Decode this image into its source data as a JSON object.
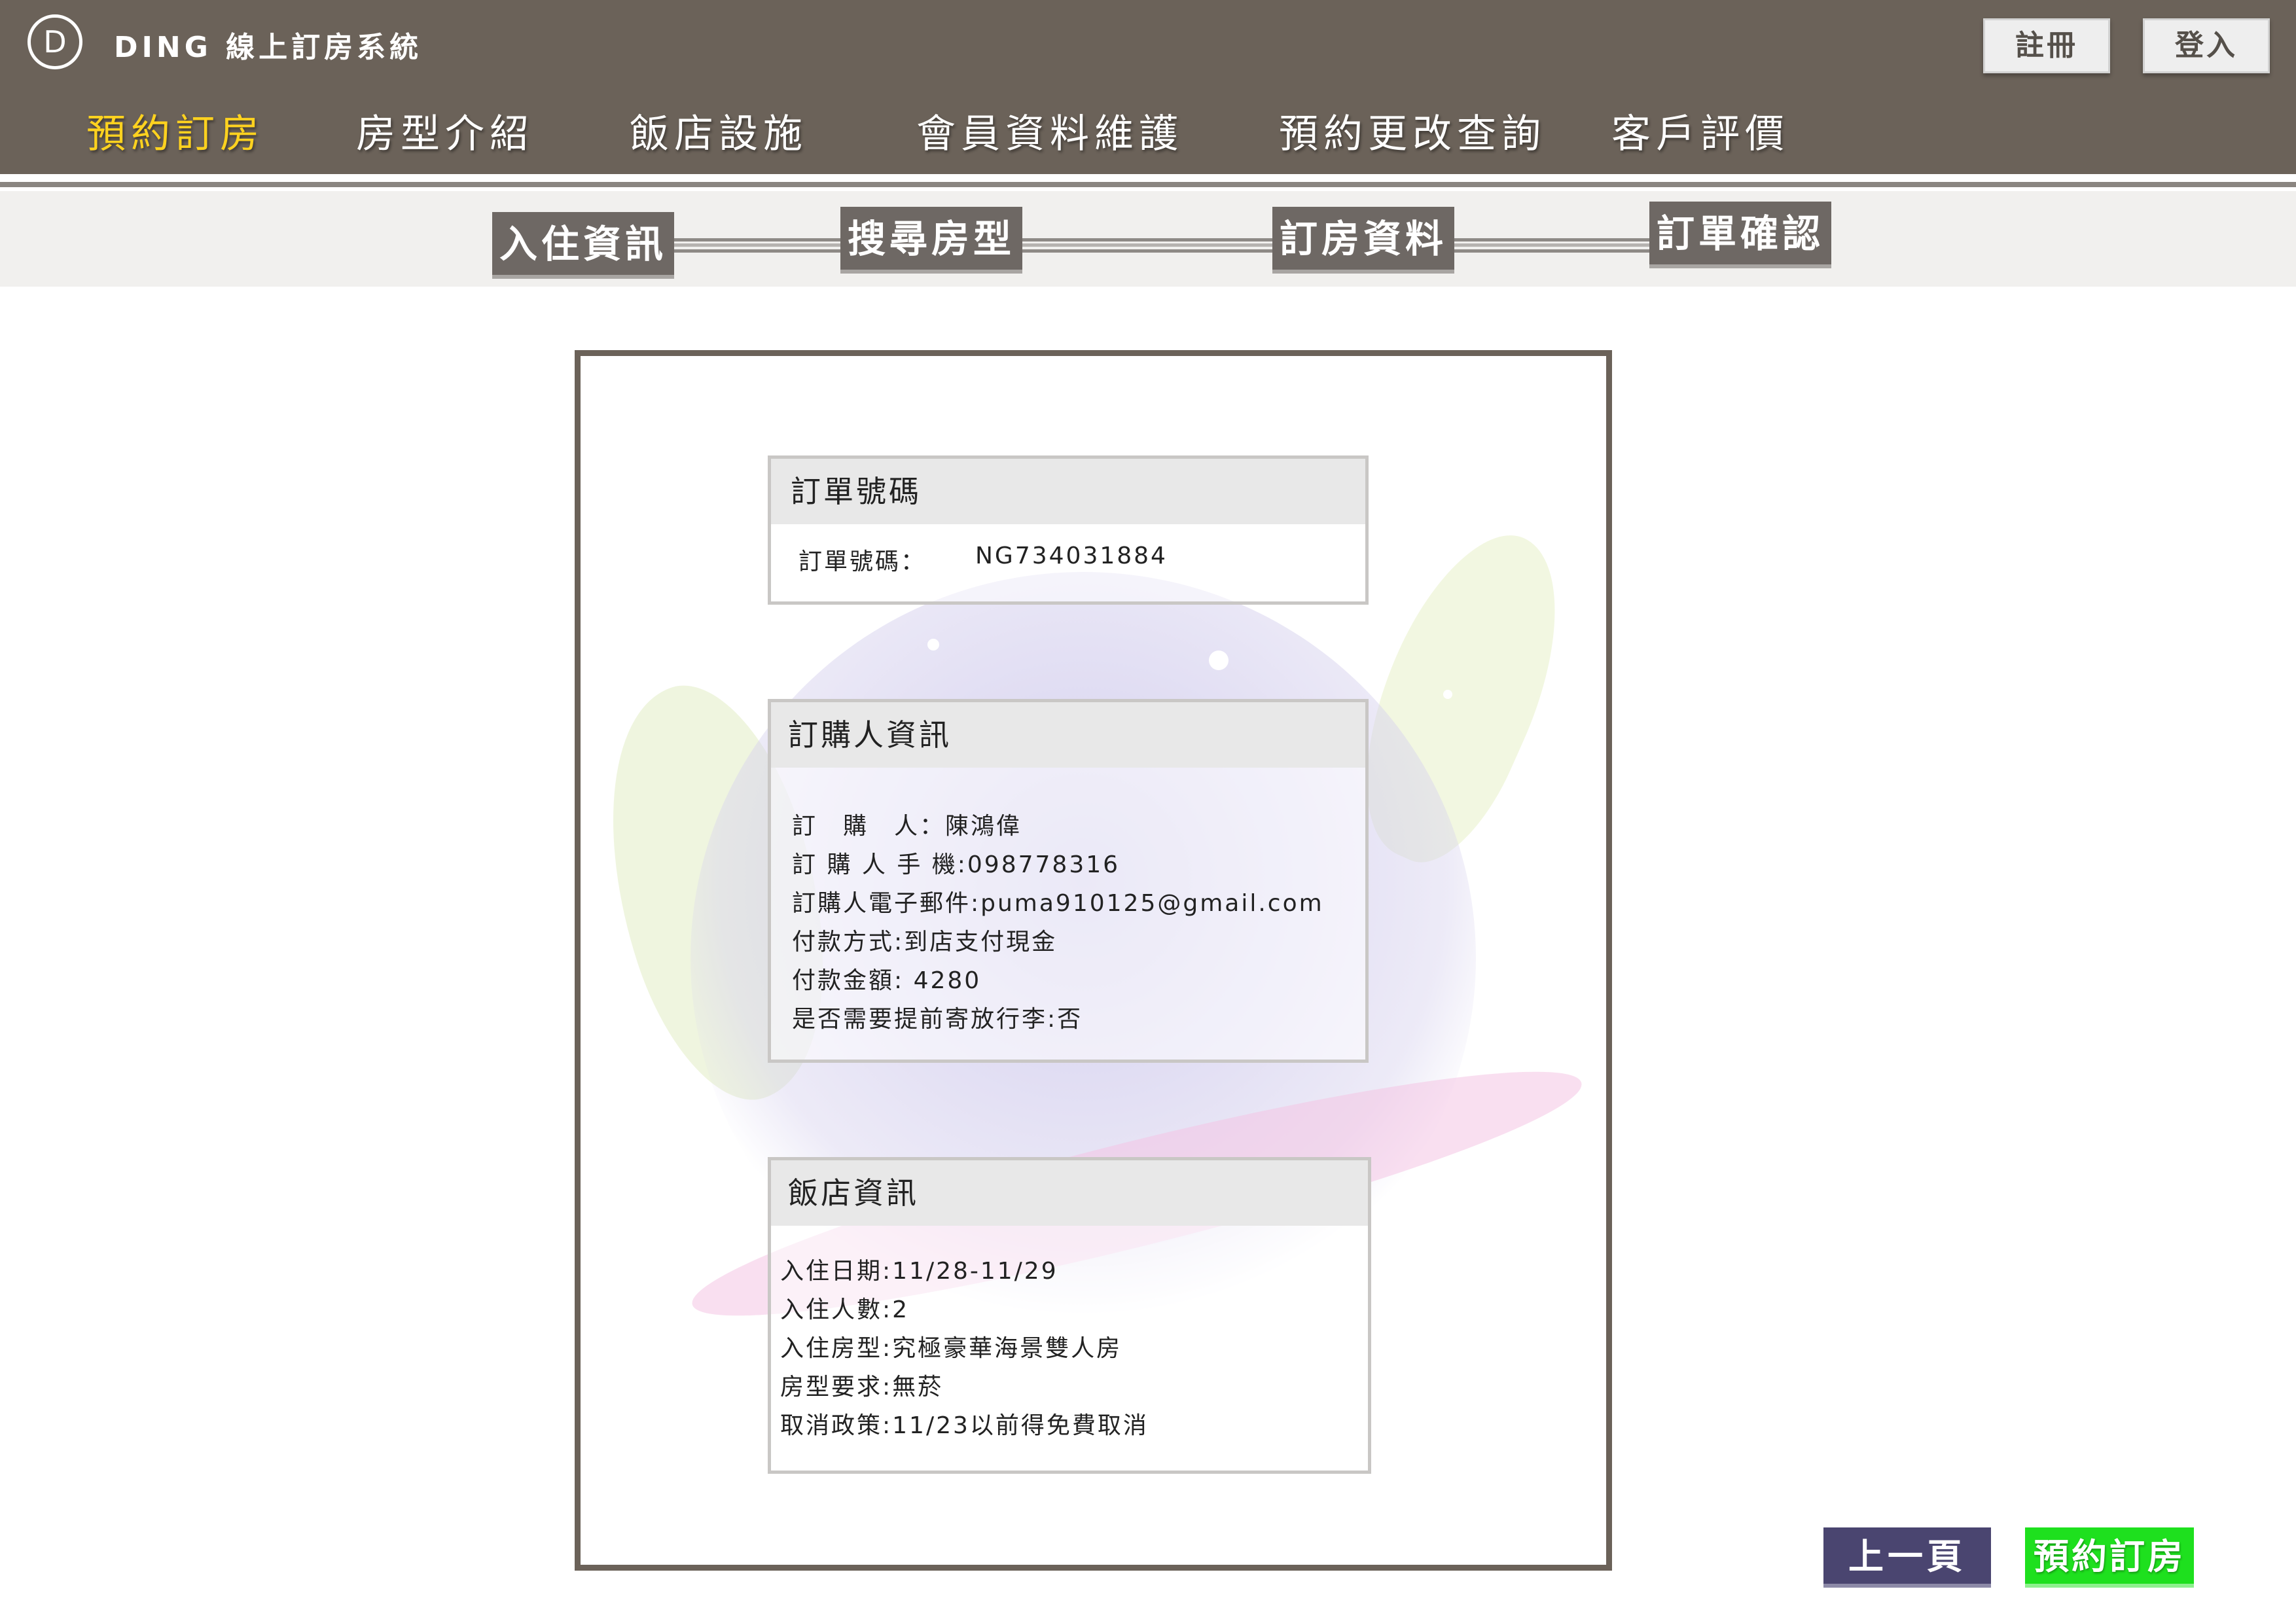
{
  "header": {
    "logo_letter": "D",
    "brand": "DING 線上訂房系統",
    "register_label": "註冊",
    "login_label": "登入",
    "nav": [
      {
        "label": "預約訂房",
        "active": true
      },
      {
        "label": "房型介紹",
        "active": false
      },
      {
        "label": "飯店設施",
        "active": false
      },
      {
        "label": "會員資料維護",
        "active": false
      },
      {
        "label": "預約更改查詢",
        "active": false
      },
      {
        "label": "客戶評價",
        "active": false
      }
    ]
  },
  "steps": [
    {
      "label": "入住資訊"
    },
    {
      "label": "搜尋房型"
    },
    {
      "label": "訂房資料"
    },
    {
      "label": "訂單確認"
    }
  ],
  "order_card": {
    "title": "訂單號碼",
    "label": "訂單號碼：",
    "value": "NG734031884"
  },
  "buyer_card": {
    "title": "訂購人資訊",
    "lines": [
      "訂　購　人：陳鴻偉",
      "訂 購 人 手 機:098778316",
      "訂購人電子郵件:puma910125@gmail.com",
      "付款方式:到店支付現金",
      "付款金額: 4280",
      "是否需要提前寄放行李:否"
    ]
  },
  "hotel_card": {
    "title": "飯店資訊",
    "lines": [
      "入住日期:11/28-11/29",
      "入住人數:2",
      "入住房型:究極豪華海景雙人房",
      "房型要求:無菸",
      "取消政策:11/23以前得免費取消"
    ]
  },
  "actions": {
    "prev_label": "上一頁",
    "book_label": "預約訂房"
  },
  "colors": {
    "header_bg": "#6b6259",
    "active_nav": "#ffd21f",
    "step_bg": "#6e6864",
    "prev_button": "#4a4570",
    "book_button": "#1ee01e"
  }
}
